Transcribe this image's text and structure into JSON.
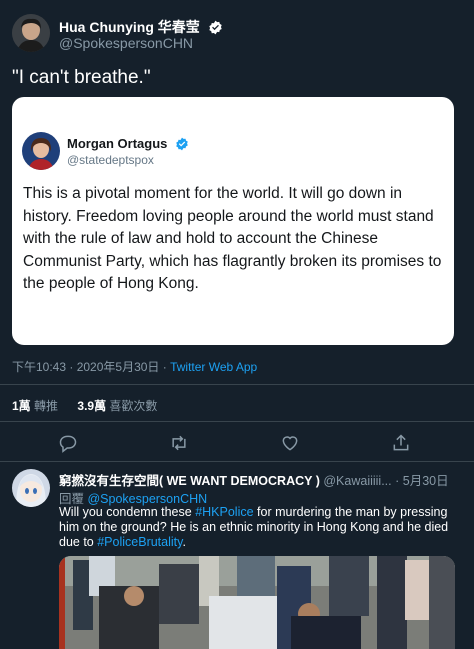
{
  "tweet": {
    "author_name": "Hua Chunying 华春莹",
    "author_handle": "@SpokespersonCHN",
    "text": "\"I can't breathe.\"",
    "meta_time": "下午10:43 · 2020年5月30日 · ",
    "meta_app": "Twitter Web App",
    "retweets_count": "1萬",
    "retweets_label": "轉推",
    "likes_count": "3.9萬",
    "likes_label": "喜歡次數"
  },
  "quote": {
    "author_name": "Morgan Ortagus",
    "author_handle": "@statedeptspox",
    "text": "This is a pivotal moment for the world. It will go down in history. Freedom loving people around the world must stand with the rule of law and hold to account the Chinese Communist Party, which has flagrantly broken its promises to the people of Hong Kong."
  },
  "actions": [
    {
      "icon": "reply-icon"
    },
    {
      "icon": "retweet-icon"
    },
    {
      "icon": "like-icon"
    },
    {
      "icon": "share-icon"
    }
  ],
  "reply": {
    "author_name": "窮撚沒有生存空間( WE WANT DEMOCRACY )",
    "author_handle": "@Kawaiiiii...",
    "time": "· 5月30日",
    "reply_prefix": "回覆 ",
    "reply_to": "@SpokespersonCHN",
    "text_1": "Will you condemn these ",
    "hashtag_1": "#HKPolice",
    "text_2": " for murdering the man by pressing him on the ground? He is an ethnic minority in Hong Kong and he died due to ",
    "hashtag_2": "#PoliceBrutality",
    "text_3": "."
  },
  "colors": {
    "background": "#15202b",
    "accent": "#1da1f2",
    "muted": "#8899a6",
    "divider": "#38444d"
  }
}
